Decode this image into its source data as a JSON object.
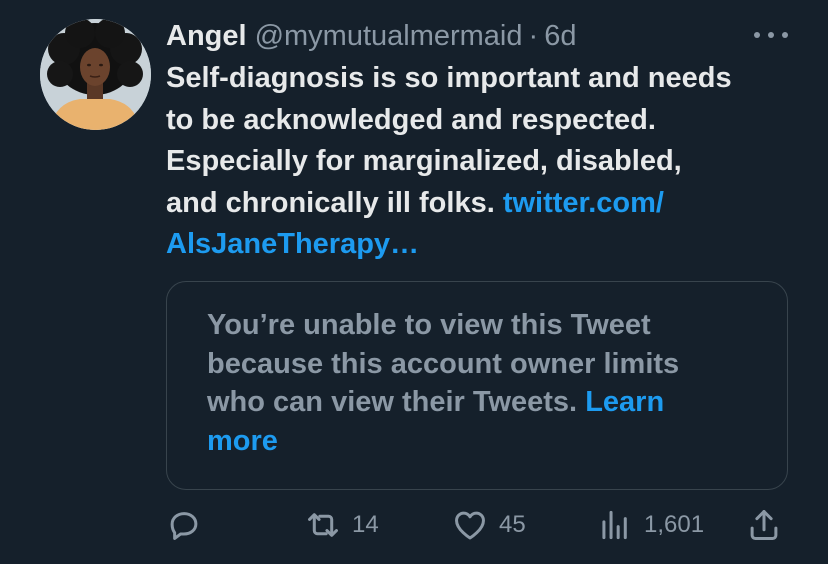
{
  "tweet": {
    "author_name": "Angel",
    "author_handle": "@mymutualmermaid",
    "separator": "·",
    "time": "6d",
    "text_lines": [
      "Self-diagnosis is so important and needs",
      "to be acknowledged and respected.",
      "Especially for marginalized, disabled,",
      "and chronically ill folks. "
    ],
    "link_part1": "twitter.com/",
    "link_part2": "AlsJaneTherapy…"
  },
  "quote": {
    "lines": [
      "You’re unable to view this Tweet",
      "because this account owner limits",
      "who can view their Tweets. "
    ],
    "learn_more_1": "Learn",
    "learn_more_2": "more"
  },
  "actions": {
    "reply_icon": "reply-icon",
    "retweet_icon": "retweet-icon",
    "retweet_count": "14",
    "like_icon": "heart-icon",
    "like_count": "45",
    "views_icon": "views-icon",
    "views_count": "1,601",
    "share_icon": "share-icon"
  },
  "colors": {
    "background": "#15202b",
    "text": "#e7e9ea",
    "muted": "#8b98a5",
    "link": "#1d9bf0",
    "border": "#38444d"
  }
}
